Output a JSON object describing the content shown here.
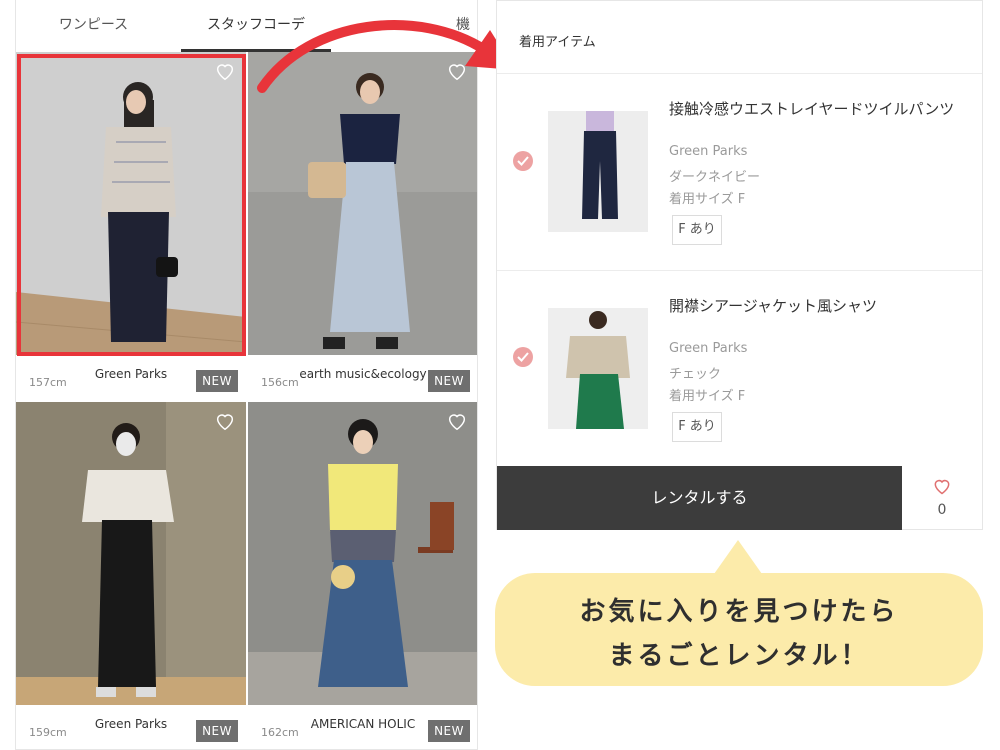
{
  "tabs": [
    {
      "label": "ワンピース"
    },
    {
      "label": "スタッフコーデ"
    },
    {
      "label": "機"
    }
  ],
  "cards": [
    {
      "brand": "Green Parks",
      "height": "157cm",
      "badge": "NEW"
    },
    {
      "brand": "earth music&ecology",
      "height": "156cm",
      "badge": "NEW"
    },
    {
      "brand": "Green Parks",
      "height": "159cm",
      "badge": "NEW"
    },
    {
      "brand": "AMERICAN HOLIC",
      "height": "162cm",
      "badge": "NEW"
    }
  ],
  "detail": {
    "section_title": "着用アイテム",
    "items": [
      {
        "name": "接触冷感ウエストレイヤードツイルパンツ",
        "brand": "Green Parks",
        "color": "ダークネイビー",
        "size": "着用サイズ F",
        "stock": "F あり"
      },
      {
        "name": "開襟シアージャケット風シャツ",
        "brand": "Green Parks",
        "color": "チェック",
        "size": "着用サイズ F",
        "stock": "F あり"
      }
    ],
    "rent_label": "レンタルする",
    "fav_count": "0"
  },
  "bubble": {
    "line1": "お気に入りを見つけたら",
    "line2": "まるごとレンタル！"
  },
  "colors": {
    "highlight": "#e8343a",
    "check": "#eda2a2",
    "bubble": "#fcebaa",
    "button": "#3c3c3c"
  }
}
